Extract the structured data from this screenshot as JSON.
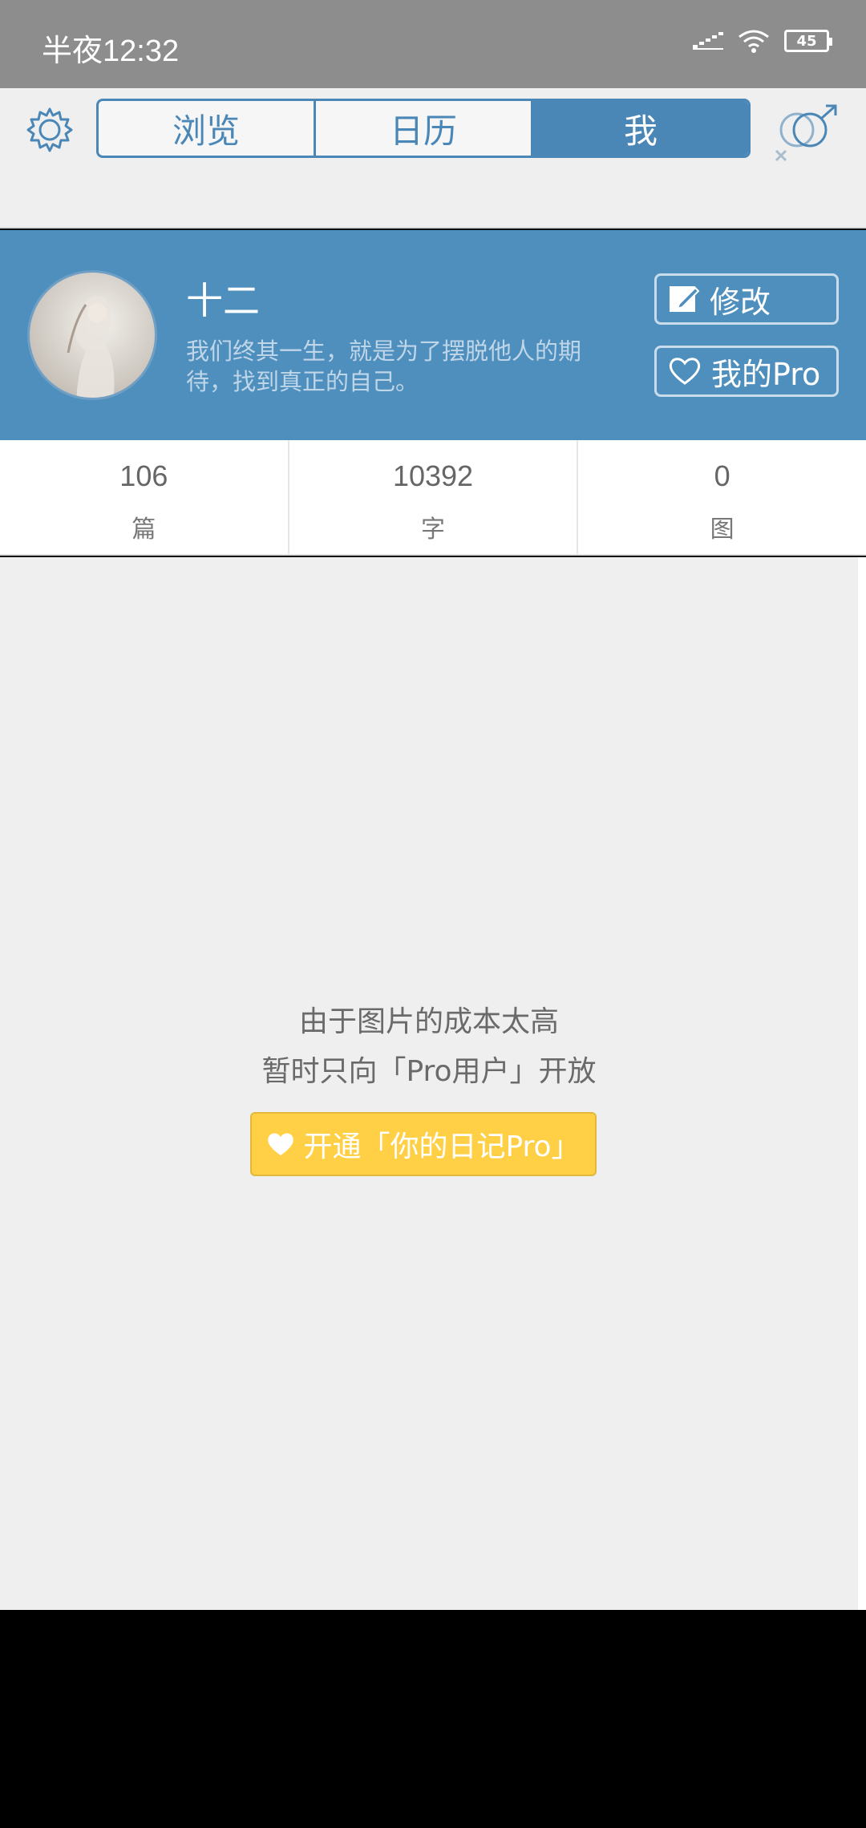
{
  "status_bar": {
    "time": "半夜12:32",
    "battery": "45"
  },
  "tabs": {
    "items": [
      {
        "label": "浏览"
      },
      {
        "label": "日历"
      },
      {
        "label": "我"
      }
    ],
    "active": "我"
  },
  "profile": {
    "name": "十二",
    "bio": "我们终其一生，就是为了摆脱他人的期待，找到真正的自己。",
    "edit_label": "修改",
    "pro_label": "我的Pro"
  },
  "stats": [
    {
      "value": "106",
      "label": "篇"
    },
    {
      "value": "10392",
      "label": "字"
    },
    {
      "value": "0",
      "label": "图"
    }
  ],
  "notice": {
    "line1": "由于图片的成本太高",
    "line2": "暂时只向「Pro用户」开放",
    "cta_label": "开通「你的日记Pro」"
  },
  "colors": {
    "accent": "#4a87b6",
    "profile_bg": "#4f8fbd",
    "cta_bg": "#ffd045"
  }
}
